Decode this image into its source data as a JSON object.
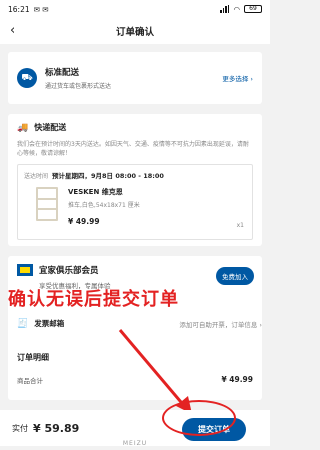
{
  "status_bar": {
    "time": "16:21",
    "battery": "69"
  },
  "nav": {
    "back_icon": "chevron-left-icon",
    "title": "订单确认"
  },
  "shipping": {
    "icon": "delivery-icon",
    "title": "标准配送",
    "subtitle": "通过货车或包裹形式送达",
    "more": "更多选择 ›"
  },
  "delivery": {
    "icon": "truck-icon",
    "title": "快递配送",
    "desc": "我们会在预计时间的3天内送达。如因天气、交通、疫情等不可抗力因素出现延误，请耐心等候，敬请谅解！",
    "slot_label": "送达时间",
    "slot_value": "预计星期四，9月8日 08:00 - 18:00",
    "product": {
      "name": "VESKEN 维克恩",
      "desc": "推车,白色,54x18x71 厘米",
      "price": "¥ 49.99",
      "qty": "x1"
    }
  },
  "member": {
    "title": "宜家俱乐部会员",
    "subtitle": "享受优惠福利，专属体验",
    "join": "免费加入"
  },
  "overlay": {
    "text": "确认无误后提交订单",
    "color": "#e32222"
  },
  "invoice": {
    "label": "发票邮箱",
    "placeholder": "添加可自助开票，订单信息 ›"
  },
  "detail": {
    "title": "订单明细",
    "row_label": "商品合计",
    "row_amount": "¥ 49.99"
  },
  "bottom": {
    "pay_label": "实付",
    "pay_amount": "¥ 59.89",
    "submit": "提交订单"
  },
  "brand": "MEIZU",
  "colors": {
    "accent": "#0058a3",
    "highlight": "#e32222"
  }
}
